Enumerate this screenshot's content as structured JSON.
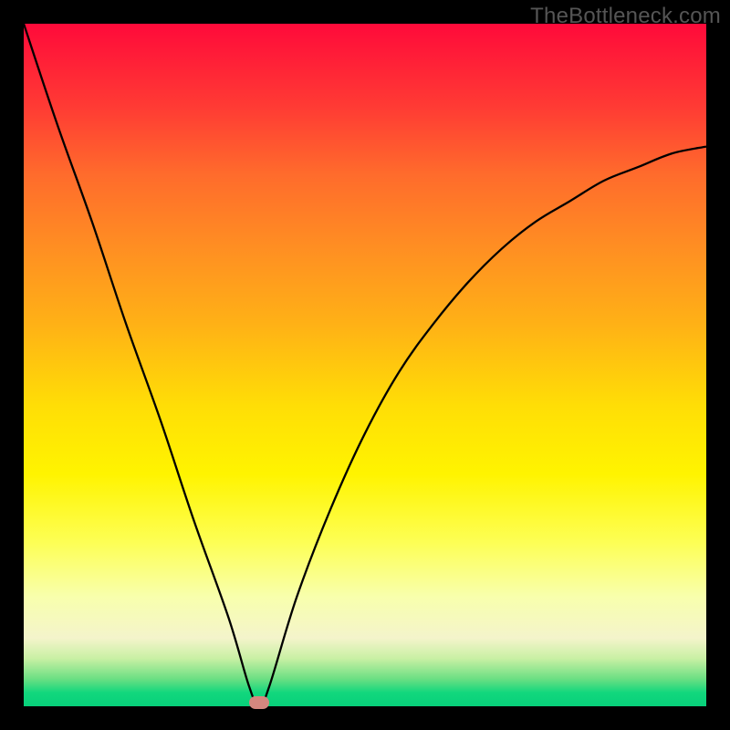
{
  "watermark": "TheBottleneck.com",
  "chart_data": {
    "type": "line",
    "title": "",
    "xlabel": "",
    "ylabel": "",
    "xlim": [
      0,
      100
    ],
    "ylim": [
      0,
      100
    ],
    "series": [
      {
        "name": "bottleneck-curve",
        "x": [
          0,
          5,
          10,
          15,
          20,
          25,
          30,
          33,
          34.5,
          36,
          40,
          45,
          50,
          55,
          60,
          65,
          70,
          75,
          80,
          85,
          90,
          95,
          100
        ],
        "values": [
          100,
          85,
          71,
          56,
          42,
          27,
          13,
          3,
          0,
          3,
          16,
          29,
          40,
          49,
          56,
          62,
          67,
          71,
          74,
          77,
          79,
          81,
          82
        ]
      }
    ],
    "marker": {
      "x": 34.5,
      "y": 0
    },
    "gradient_stops": [
      {
        "pos": 0,
        "color": "#ff0a3a"
      },
      {
        "pos": 12,
        "color": "#ff3a34"
      },
      {
        "pos": 22,
        "color": "#ff6b2c"
      },
      {
        "pos": 33,
        "color": "#ff8f22"
      },
      {
        "pos": 44,
        "color": "#ffb116"
      },
      {
        "pos": 56,
        "color": "#ffde06"
      },
      {
        "pos": 66,
        "color": "#fff400"
      },
      {
        "pos": 76,
        "color": "#fdff55"
      },
      {
        "pos": 84,
        "color": "#f8ffad"
      },
      {
        "pos": 90,
        "color": "#f4f4cb"
      },
      {
        "pos": 93,
        "color": "#c9f0a4"
      },
      {
        "pos": 96,
        "color": "#6bdf83"
      },
      {
        "pos": 98,
        "color": "#12d77d"
      },
      {
        "pos": 100,
        "color": "#07d07a"
      }
    ]
  }
}
